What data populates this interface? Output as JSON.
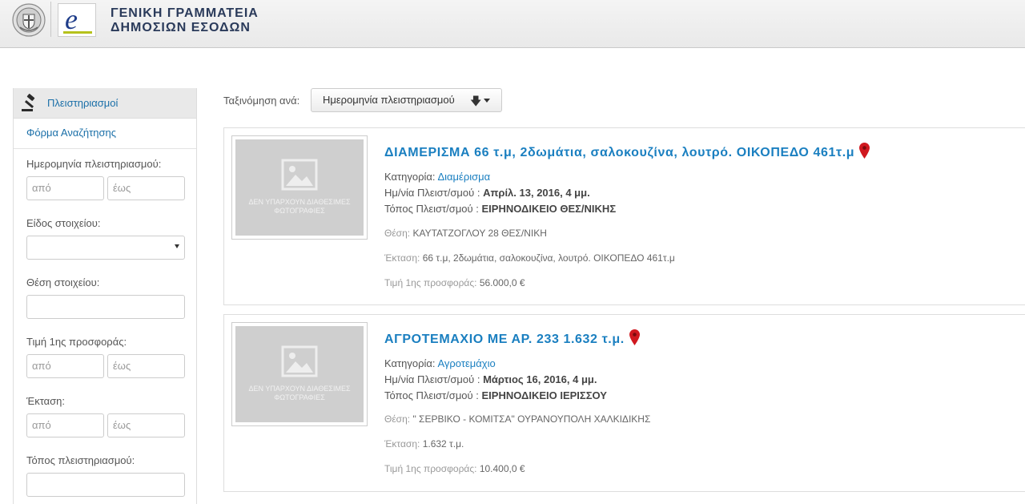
{
  "header": {
    "brand_line1": "ΓΕΝΙΚΗ ΓΡΑΜΜΑΤΕΙΑ",
    "brand_line2": "ΔΗΜΟΣΙΩΝ ΕΣΟΔΩΝ"
  },
  "sidebar": {
    "section_title": "Πλειστηριασμοί",
    "search_form_link": "Φόρμα Αναζήτησης",
    "date_label": "Ημερομηνία πλειστηριασμού:",
    "date_from_placeholder": "από",
    "date_to_placeholder": "έως",
    "type_label": "Είδος στοιχείου:",
    "location_label": "Θέση στοιχείου:",
    "price_label": "Τιμή 1ης προσφοράς:",
    "price_from_placeholder": "από",
    "price_to_placeholder": "έως",
    "area_label": "Έκταση:",
    "area_from_placeholder": "από",
    "area_to_placeholder": "έως",
    "auction_place_label": "Τόπος πλειστηριασμού:"
  },
  "sort": {
    "label": "Ταξινόμηση ανά:",
    "selected": "Ημερομηνία πλειστηριασμού"
  },
  "no_photo_line1": "ΔΕΝ ΥΠΑΡΧΟΥΝ ΔΙΑΘΕΣΙΜΕΣ",
  "no_photo_line2": "ΦΩΤΟΓΡΑΦΙΕΣ",
  "labels": {
    "category": "Κατηγορία:",
    "auction_date": "Ημ/νία Πλειστ/σμού :",
    "auction_place": "Τόπος Πλειστ/σμού :",
    "location": "Θέση:",
    "area": "Έκταση:",
    "first_offer": "Τιμή 1ης προσφοράς:"
  },
  "listings": [
    {
      "title": "ΔΙΑΜΕΡΙΣΜΑ 66 τ.μ, 2δωμάτια, σαλοκουζίνα, λουτρό. ΟΙΚΟΠΕΔΟ 461τ.μ",
      "category": "Διαμέρισμα",
      "auction_date": "Απρίλ. 13, 2016, 4 μμ.",
      "auction_place": "ΕΙΡΗΝΟΔΙΚΕΙΟ ΘΕΣ/ΝΙΚΗΣ",
      "location": "ΚΑΥΤΑΤΖΟΓΛΟΥ 28 ΘΕΣ/ΝΙΚΗ",
      "area": "66 τ.μ, 2δωμάτια, σαλοκουζίνα, λουτρό. ΟΙΚΟΠΕΔΟ 461τ.μ",
      "first_offer": "56.000,0 €"
    },
    {
      "title": "ΑΓΡΟΤΕΜΑΧΙΟ ΜΕ ΑΡ. 233 1.632 τ.μ.",
      "category": "Αγροτεμάχιο",
      "auction_date": "Μάρτιος 16, 2016, 4 μμ.",
      "auction_place": "ΕΙΡΗΝΟΔΙΚΕΙΟ ΙΕΡΙΣΣΟΥ",
      "location": "\" ΣΕΡΒΙΚΟ - ΚΟΜΙΤΣΑ\" ΟΥΡΑΝΟΥΠΟΛΗ ΧΑΛΚΙΔΙΚΗΣ",
      "area": "1.632 τ.μ.",
      "first_offer": "10.400,0 €"
    }
  ],
  "colors": {
    "link_blue": "#1a7fc0",
    "pin_red": "#d0181f"
  }
}
